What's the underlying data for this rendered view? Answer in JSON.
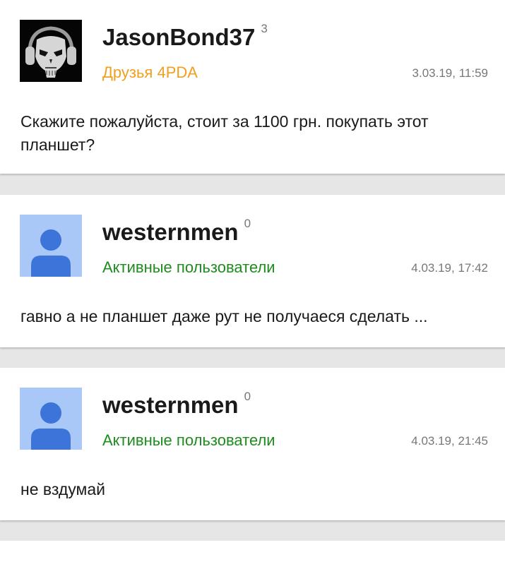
{
  "posts": [
    {
      "username": "JasonBond37",
      "reputation": "3",
      "group": "Друзья 4PDA",
      "group_color": "#f0a020",
      "date": "3.03.19, 11:59",
      "text": "Скажите пожалуйста, стоит за 1100 грн. покупать этот планшет?",
      "avatar_icon": "skull-headphones-avatar"
    },
    {
      "username": "westernmen",
      "reputation": "0",
      "group": "Активные пользователи",
      "group_color": "#1e8c1e",
      "date": "4.03.19, 17:42",
      "text": "гавно а не планшет даже рут не получаеся сделать ...",
      "avatar_icon": "default-user-avatar"
    },
    {
      "username": "westernmen",
      "reputation": "0",
      "group": "Активные пользователи",
      "group_color": "#1e8c1e",
      "date": "4.03.19, 21:45",
      "text": "не вздумай",
      "avatar_icon": "default-user-avatar"
    }
  ]
}
